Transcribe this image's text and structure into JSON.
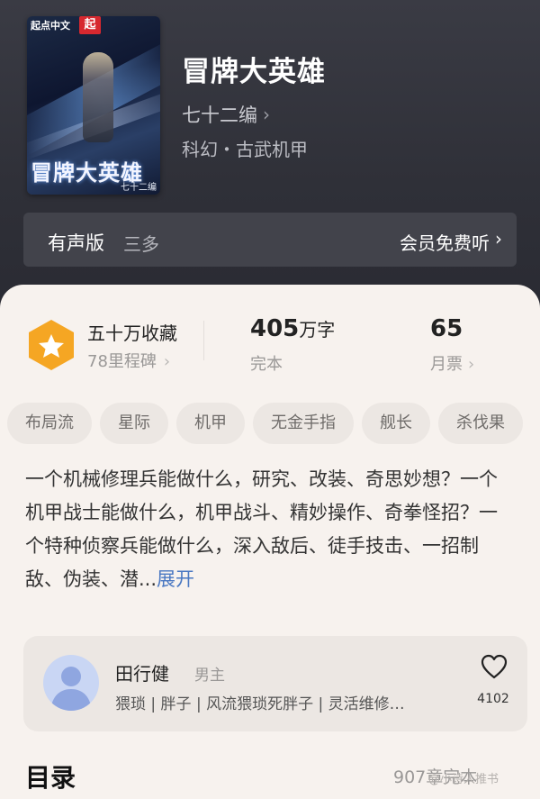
{
  "book": {
    "cover_brand": "起点中文",
    "cover_brand_mark": "起",
    "cover_title": "冒牌大英雄",
    "cover_author": "七十二编",
    "title": "冒牌大英雄",
    "author": "七十二编",
    "genre": "科幻・古武机甲"
  },
  "audio": {
    "label": "有声版",
    "narrator": "三多",
    "free_label": "会员免费听"
  },
  "stats": {
    "collections": "五十万收藏",
    "milestone": "78里程碑",
    "word_count_num": "405",
    "word_count_unit": "万字",
    "status": "完本",
    "monthly_votes": "65",
    "monthly_votes_label": "月票"
  },
  "tags": [
    "布局流",
    "星际",
    "机甲",
    "无金手指",
    "舰长",
    "杀伐果"
  ],
  "description": {
    "text": "一个机械修理兵能做什么，研究、改装、奇思妙想？一个机甲战士能做什么，机甲战斗、精妙操作、奇拳怪招？一个特种侦察兵能做什么，深入敌后、徒手技击、一招制敌、伪装、潜...",
    "expand": "展开"
  },
  "character": {
    "name": "田行健",
    "role": "男主",
    "traits": "猥琐 | 胖子 | 风流猥琐死胖子 | 灵活维修…",
    "likes": "4102"
  },
  "toc": {
    "title": "目录",
    "info": "907章完本",
    "watermark": "@小诗人推书"
  },
  "colors": {
    "badge": "#f5a623",
    "link": "#4a78c2",
    "sheet_bg": "#f7f2ee"
  }
}
